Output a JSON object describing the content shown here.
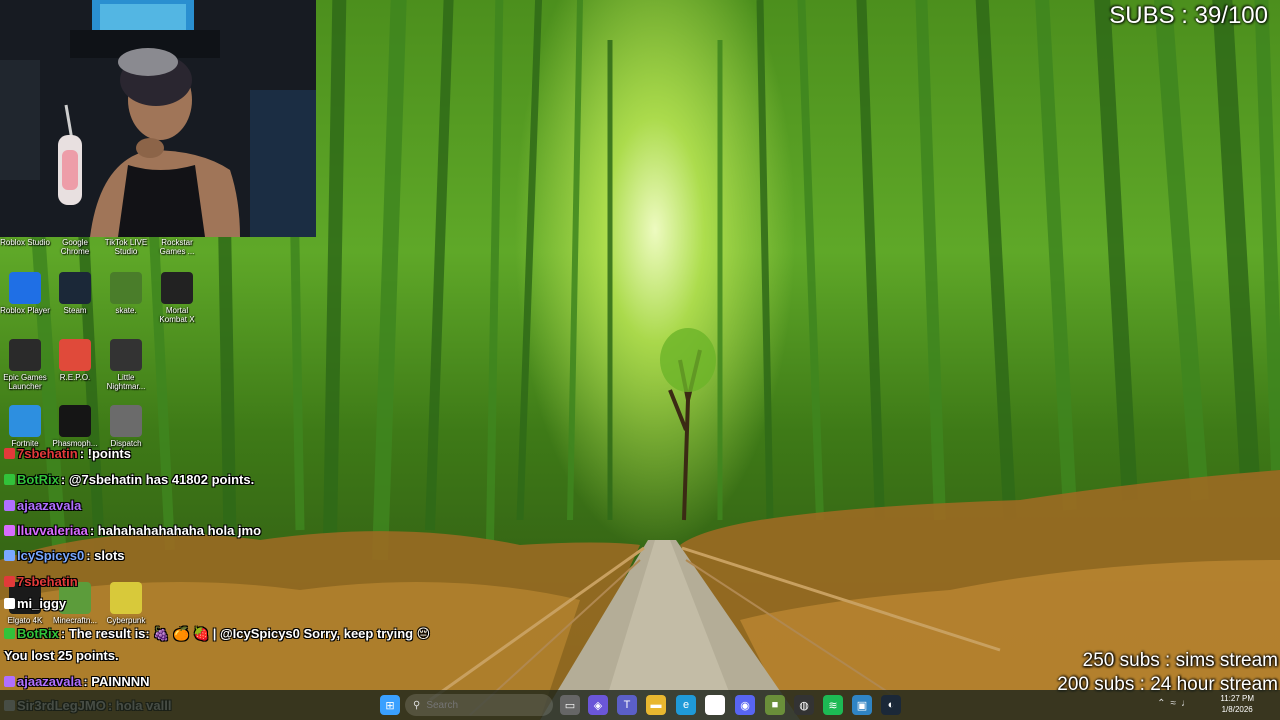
{
  "overlay": {
    "subs_counter": "SUBS : 39/100",
    "goals": [
      "250 subs : sims stream",
      "200 subs : 24 hour stream"
    ]
  },
  "desktop_icons": [
    {
      "label": "Roblox Studio",
      "icon": "roblox-studio-icon",
      "color": "#2b6cd6"
    },
    {
      "label": "Google Chrome",
      "icon": "chrome-icon",
      "color": "#e0a020"
    },
    {
      "label": "TikTok LIVE Studio",
      "icon": "tiktok-icon",
      "color": "#111111"
    },
    {
      "label": "Rockstar Games ...",
      "icon": "rockstar-icon",
      "color": "#f2a900"
    },
    {
      "label": "Roblox Player",
      "icon": "roblox-player-icon",
      "color": "#1f6fe5"
    },
    {
      "label": "Steam",
      "icon": "steam-icon",
      "color": "#1b2838"
    },
    {
      "label": "skate.",
      "icon": "skate-icon",
      "color": "#4a7d2a"
    },
    {
      "label": "Mortal Kombat X",
      "icon": "mortal-kombat-icon",
      "color": "#222222"
    },
    {
      "label": "Epic Games Launcher",
      "icon": "epic-games-icon",
      "color": "#2a2a2a"
    },
    {
      "label": "R.E.P.O.",
      "icon": "repo-icon",
      "color": "#e04a3a"
    },
    {
      "label": "Little Nightmar...",
      "icon": "little-nightmares-icon",
      "color": "#333333"
    },
    {
      "label": "Fortnite",
      "icon": "fortnite-icon",
      "color": "#2d8fe0"
    },
    {
      "label": "Phasmoph...",
      "icon": "phasmophobia-icon",
      "color": "#151515"
    },
    {
      "label": "Dispatch",
      "icon": "dispatch-icon",
      "color": "#6b6b6b"
    },
    {
      "label": "Elgato 4K",
      "icon": "elgato-icon",
      "color": "#1a1a1a"
    },
    {
      "label": "Minecraftn...",
      "icon": "minecraft-icon",
      "color": "#5c9c3b"
    },
    {
      "label": "Cyberpunk",
      "icon": "cyberpunk-icon",
      "color": "#d8c93a"
    }
  ],
  "chat": [
    {
      "user": "7sbehatin",
      "user_color": "#e23a3a",
      "message": "!points"
    },
    {
      "user": "BotRix",
      "user_color": "#32c23a",
      "message": "@7sbehatin has 41802 points."
    },
    {
      "user": "ajaazavala",
      "user_color": "#b070ff",
      "message": ""
    },
    {
      "user": "lluvvaleriaa",
      "user_color": "#d86cff",
      "message": "hahahahahahaha hola jmo"
    },
    {
      "user": "IcySpicys0",
      "user_color": "#7aa8ff",
      "message": "slots"
    },
    {
      "user": "7sbehatin",
      "user_color": "#e23a3a",
      "message": ""
    },
    {
      "user": "mi_iggy",
      "user_color": "#ffffff",
      "message": ""
    },
    {
      "user": "BotRix",
      "user_color": "#32c23a",
      "message": "The result is: 🍇 🍊 🍓 | @IcySpicys0 Sorry, keep trying 😔"
    },
    {
      "user": "",
      "user_color": "#ffffff",
      "message": "You lost 25 points."
    },
    {
      "user": "ajaazavala",
      "user_color": "#b070ff",
      "message": "PAINNNN"
    },
    {
      "user": "Sir3rdLegJMO",
      "user_color": "#ffffff",
      "message": "hola valll"
    }
  ],
  "taskbar": {
    "search_placeholder": "Search",
    "clock_time": "11:27 PM",
    "clock_date": "1/8/2026",
    "apps": [
      {
        "name": "windows-start-icon",
        "color": "#3aa0ff",
        "glyph": "⊞"
      },
      {
        "name": "task-view-icon",
        "color": "#666666",
        "glyph": "▭"
      },
      {
        "name": "copilot-icon",
        "color": "#6b56d8",
        "glyph": "◈"
      },
      {
        "name": "teams-icon",
        "color": "#5b5fc7",
        "glyph": "T"
      },
      {
        "name": "file-explorer-icon",
        "color": "#e8b730",
        "glyph": "▬"
      },
      {
        "name": "edge-icon",
        "color": "#1f9ad8",
        "glyph": "e"
      },
      {
        "name": "store-icon",
        "color": "#ffffff",
        "glyph": "▦"
      },
      {
        "name": "discord-icon",
        "color": "#5865f2",
        "glyph": "◉"
      },
      {
        "name": "minecraft-launcher-icon",
        "color": "#6a8f3a",
        "glyph": "■"
      },
      {
        "name": "obs-icon",
        "color": "#333333",
        "glyph": "◍"
      },
      {
        "name": "spotify-icon",
        "color": "#1db954",
        "glyph": "≋"
      },
      {
        "name": "desktop-app-icon",
        "color": "#2f84c4",
        "glyph": "▣"
      },
      {
        "name": "steam-taskbar-icon",
        "color": "#1b2838",
        "glyph": "◐"
      }
    ]
  }
}
